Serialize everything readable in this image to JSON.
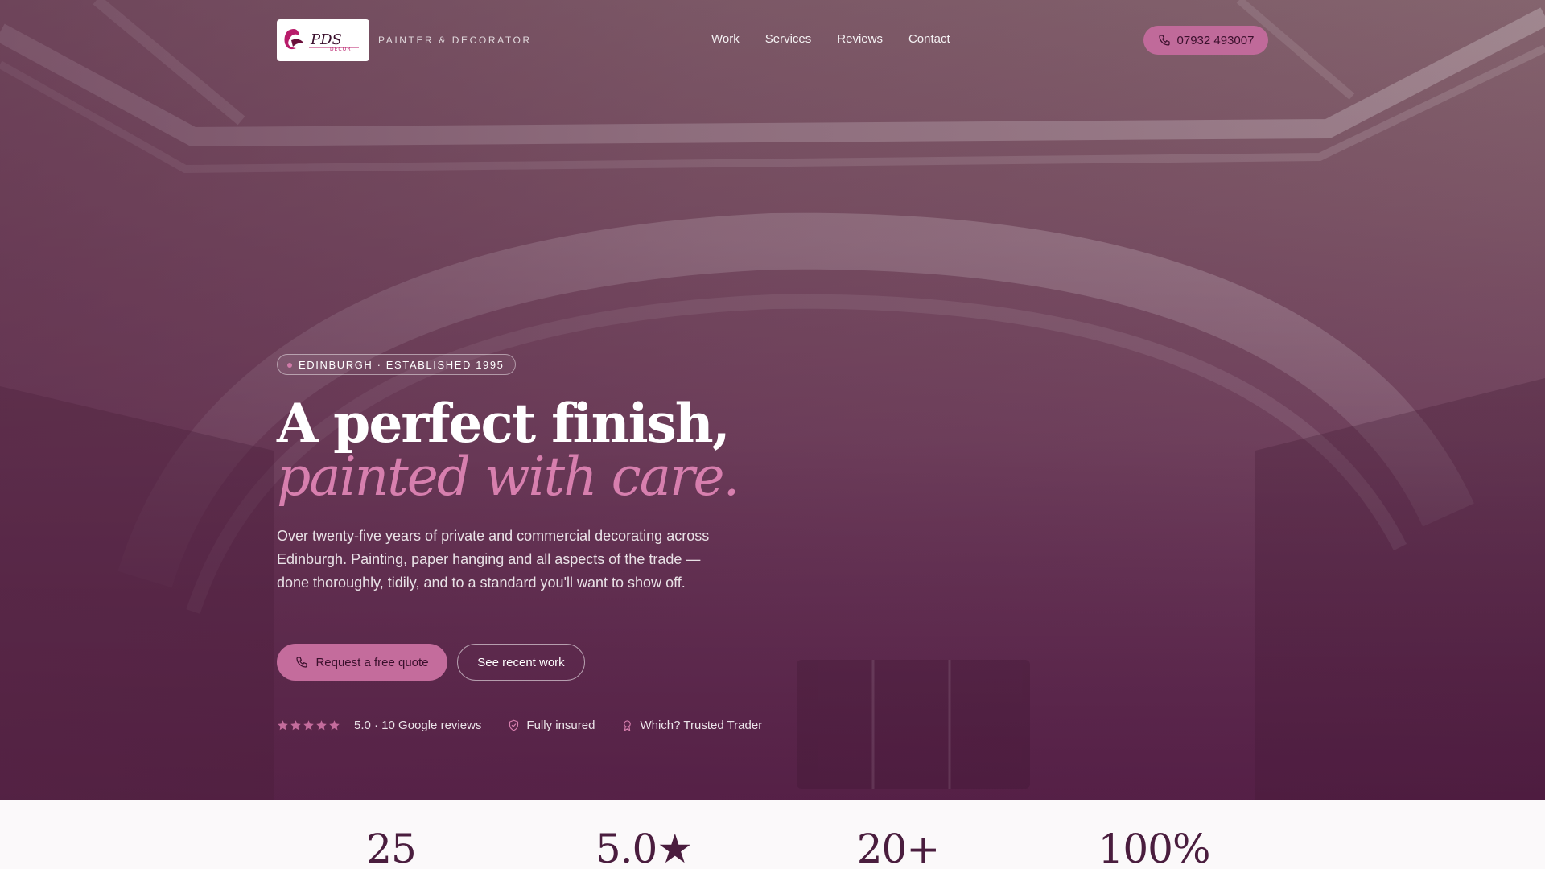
{
  "header": {
    "logo_text": "PDS",
    "logo_subtext": "DECOR",
    "tagline": "PAINTER & DECORATOR",
    "nav": [
      {
        "label": "Work"
      },
      {
        "label": "Services"
      },
      {
        "label": "Reviews"
      },
      {
        "label": "Contact"
      }
    ],
    "phone": "07932 493007",
    "phone_icon": "phone-icon"
  },
  "hero": {
    "badge": "EDINBURGH · ESTABLISHED 1995",
    "headline_line1": "A perfect finish,",
    "headline_line2": "painted with care.",
    "lead": "Over twenty-five years of private and commercial decorating across Edinburgh. Painting, paper hanging and all aspects of the trade — done thoroughly, tidily, and to a standard you'll want to show off.",
    "primary_cta": "Request a free quote",
    "secondary_cta": "See recent work",
    "proof": {
      "rating_stars": 5,
      "rating_text": "5.0 · 10 Google reviews",
      "insured_text": "Fully insured",
      "insured_icon": "shield-check-icon",
      "trader_text": "Which? Trusted Trader",
      "trader_icon": "award-icon"
    }
  },
  "stats": [
    {
      "value": "25"
    },
    {
      "value": "5.0★"
    },
    {
      "value": "20+"
    },
    {
      "value": "100%"
    }
  ],
  "colors": {
    "accent": "#c46c9c",
    "accent_text": "#d77fae",
    "dark_plum": "#4a1d3e",
    "hero_bottom": "#56234a"
  }
}
